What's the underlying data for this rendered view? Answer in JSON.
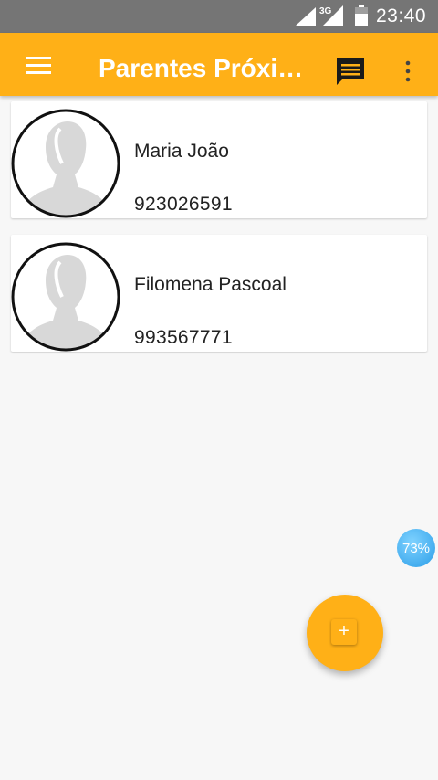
{
  "status_bar": {
    "network": "3G",
    "time": "23:40"
  },
  "app_bar": {
    "title": "Parentes Próximos",
    "icons": [
      "menu-icon",
      "chat-icon",
      "more-vert-icon"
    ],
    "color": "#ffb017"
  },
  "contacts": [
    {
      "name": "Maria João",
      "phone": "923026591"
    },
    {
      "name": "Filomena Pascoal",
      "phone": "993567771"
    }
  ],
  "progress_badge": {
    "text": "73%",
    "value": 73
  },
  "fab": {
    "label": "+",
    "icon": "add-icon"
  }
}
